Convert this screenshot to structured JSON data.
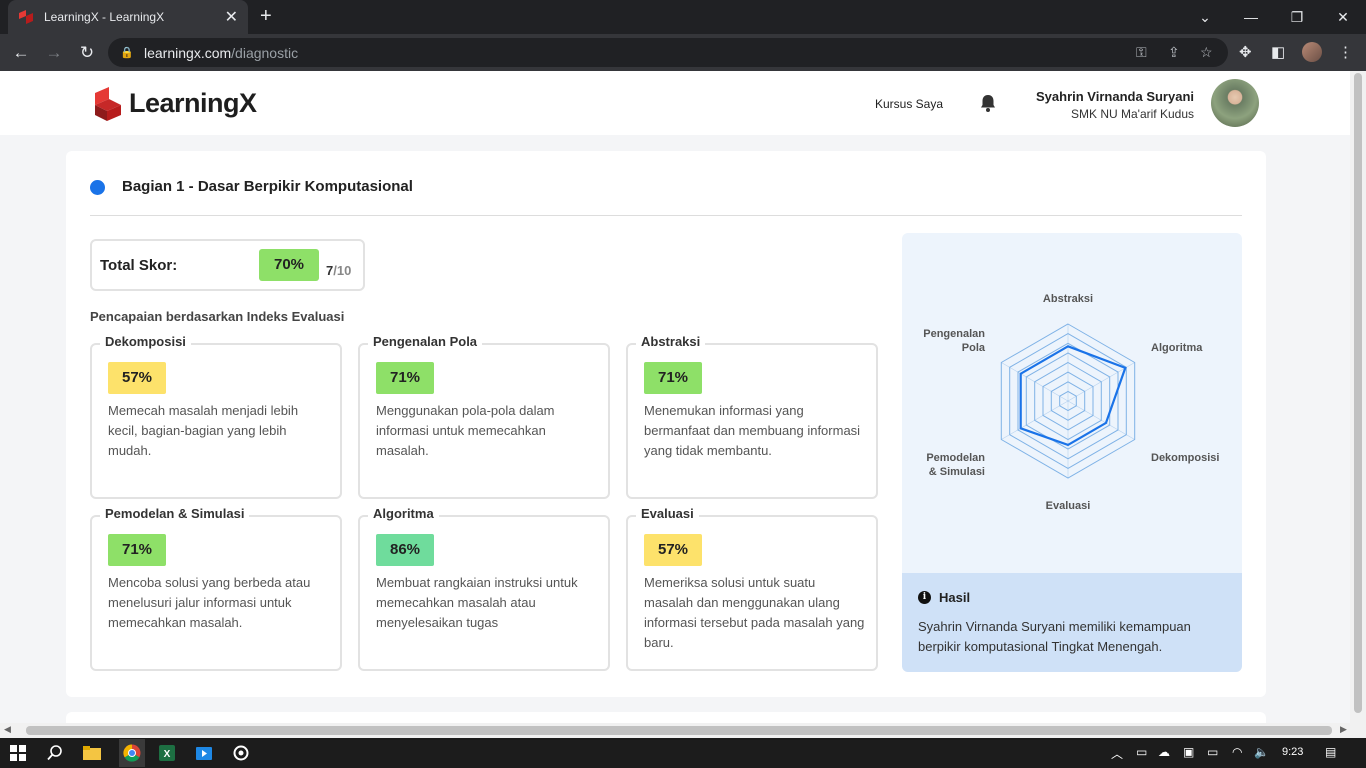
{
  "browser": {
    "tab_title": "LearningX - LearningX",
    "url_host": "learningx.com",
    "url_path": "/diagnostic"
  },
  "header": {
    "logo_text": "LearningX",
    "nav_kursus": "Kursus Saya",
    "user_name": "Syahrin Virnanda Suryani",
    "user_school": "SMK NU Ma'arif Kudus"
  },
  "section": {
    "title": "Bagian 1 - Dasar Berpikir Komputasional",
    "total_label": "Total Skor:",
    "total_pct": "70%",
    "total_score": "7",
    "total_max": "/10",
    "subtitle": "Pencapaian berdasarkan Indeks Evaluasi"
  },
  "indices": [
    {
      "name": "Dekomposisi",
      "pct": "57%",
      "color": "#fde26b",
      "desc": "Memecah masalah menjadi lebih kecil, bagian-bagian yang lebih mudah."
    },
    {
      "name": "Pengenalan Pola",
      "pct": "71%",
      "color": "#8ee068",
      "desc": "Menggunakan pola-pola dalam informasi untuk memecahkan masalah."
    },
    {
      "name": "Abstraksi",
      "pct": "71%",
      "color": "#8ee068",
      "desc": "Menemukan informasi yang bermanfaat dan membuang informasi yang tidak membantu."
    },
    {
      "name": "Pemodelan & Simulasi",
      "pct": "71%",
      "color": "#8ee068",
      "desc": "Mencoba solusi yang berbeda atau menelusuri jalur informasi untuk memecahkan masalah."
    },
    {
      "name": "Algoritma",
      "pct": "86%",
      "color": "#6fdc9c",
      "desc": "Membuat rangkaian instruksi untuk memecahkan masalah atau menyelesaikan tugas"
    },
    {
      "name": "Evaluasi",
      "pct": "57%",
      "color": "#fde26b",
      "desc": "Memeriksa solusi untuk suatu masalah dan menggunakan ulang informasi tersebut pada masalah yang baru."
    }
  ],
  "radar": {
    "labels": {
      "abstraksi": "Abstraksi",
      "algoritma": "Algoritma",
      "dekomposisi": "Dekomposisi",
      "evaluasi": "Evaluasi",
      "pemodelan_1": "Pemodelan",
      "pemodelan_2": "& Simulasi",
      "pengenalan_1": "Pengenalan",
      "pengenalan_2": "Pola"
    },
    "line_color": "#1a73e8",
    "grid_color": "#7fb2e6"
  },
  "chart_data": {
    "type": "radar",
    "axes": [
      "Abstraksi",
      "Algoritma",
      "Dekomposisi",
      "Evaluasi",
      "Pemodelan & Simulasi",
      "Pengenalan Pola"
    ],
    "values": [
      71,
      86,
      57,
      57,
      71,
      71
    ],
    "max": 100
  },
  "hasil": {
    "title": "Hasil",
    "text": "Syahrin Virnanda Suryani memiliki kemampuan berpikir komputasional Tingkat Menengah."
  },
  "taskbar": {
    "time": "9:23"
  }
}
